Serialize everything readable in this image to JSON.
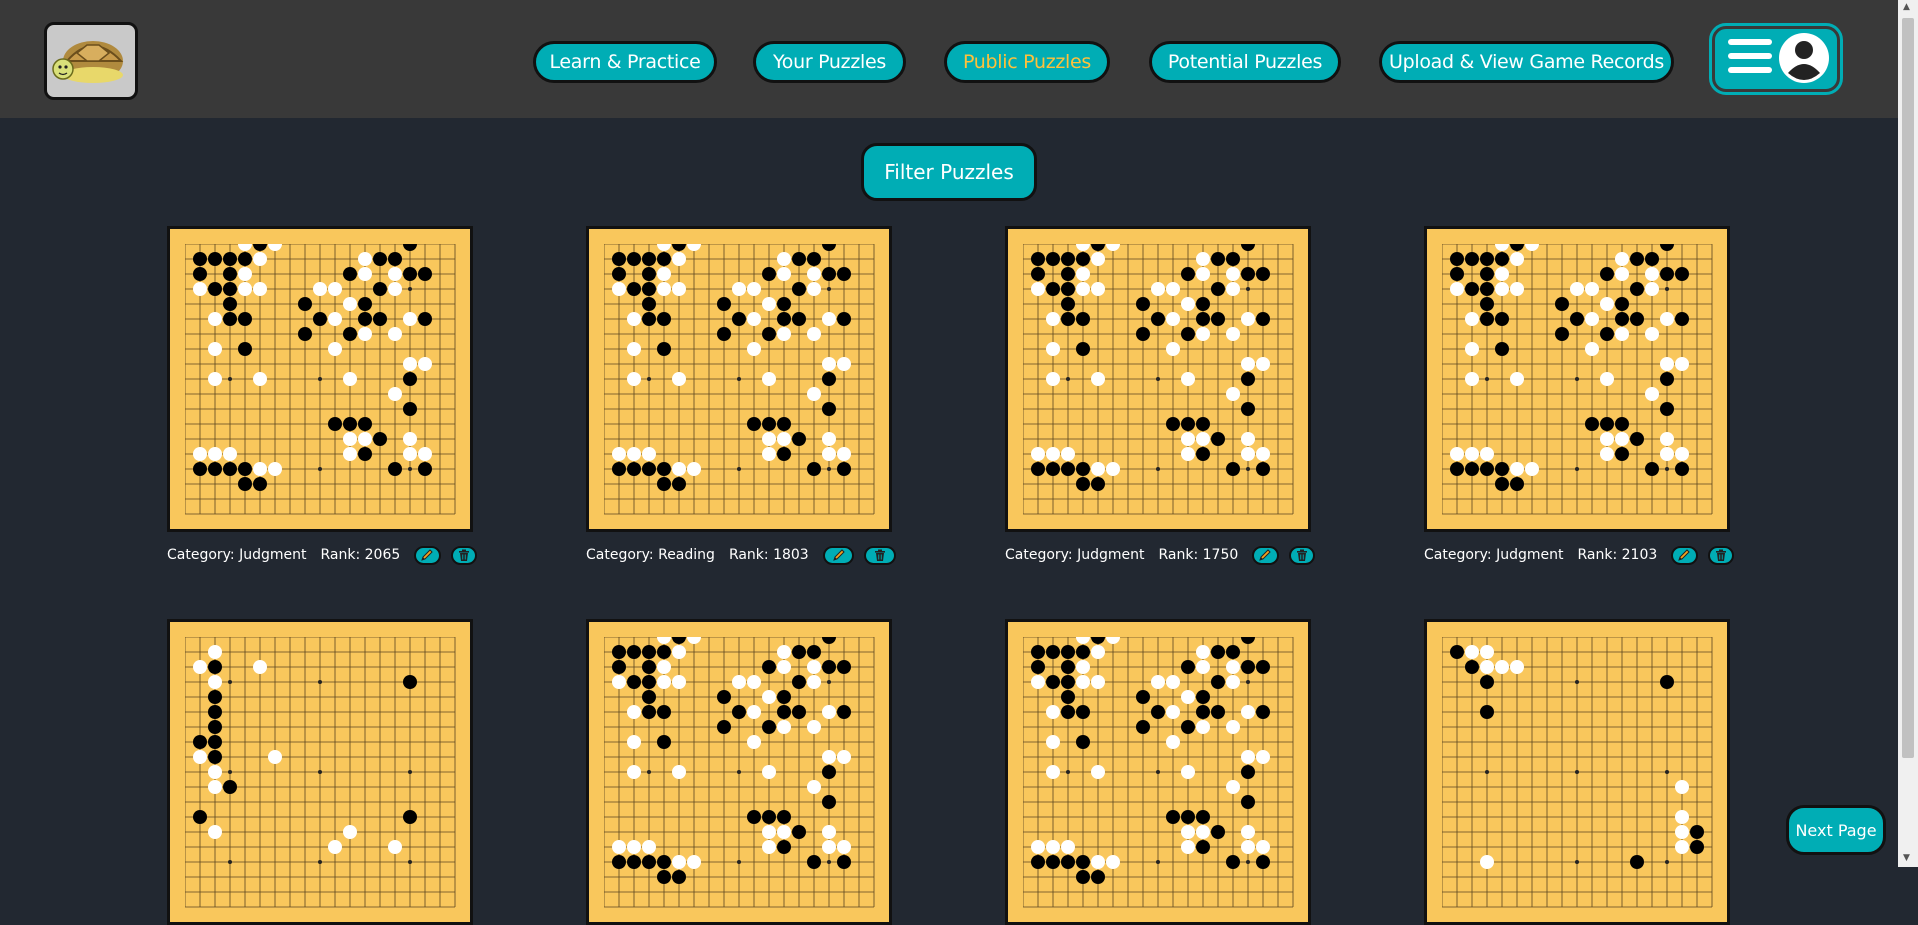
{
  "header": {
    "nav": [
      {
        "label": "Learn & Practice",
        "active": false
      },
      {
        "label": "Your Puzzles",
        "active": false
      },
      {
        "label": "Public Puzzles",
        "active": true
      },
      {
        "label": "Potential Puzzles",
        "active": false
      },
      {
        "label": "Upload & View Game Records",
        "active": false
      }
    ],
    "menu_icons": [
      "hamburger-icon",
      "user-avatar-icon"
    ],
    "active_color": "#ffc13b"
  },
  "filter": {
    "label": "Filter Puzzles"
  },
  "colors": {
    "accent": "#00adb5",
    "board": "#f9c75c",
    "background": "#222831",
    "header": "#393939"
  },
  "puzzles": [
    {
      "category": "Category: Judgment",
      "rank": "Rank: 2065"
    },
    {
      "category": "Category: Reading",
      "rank": "Rank: 1803"
    },
    {
      "category": "Category: Judgment",
      "rank": "Rank: 1750"
    },
    {
      "category": "Category: Judgment",
      "rank": "Rank: 2103"
    },
    {
      "category": "",
      "rank": ""
    },
    {
      "category": "",
      "rank": ""
    },
    {
      "category": "",
      "rank": ""
    },
    {
      "category": "",
      "rank": ""
    }
  ],
  "card_icons": [
    "pencil-icon",
    "trash-icon"
  ],
  "pagination": {
    "next_label": "Next Page"
  }
}
